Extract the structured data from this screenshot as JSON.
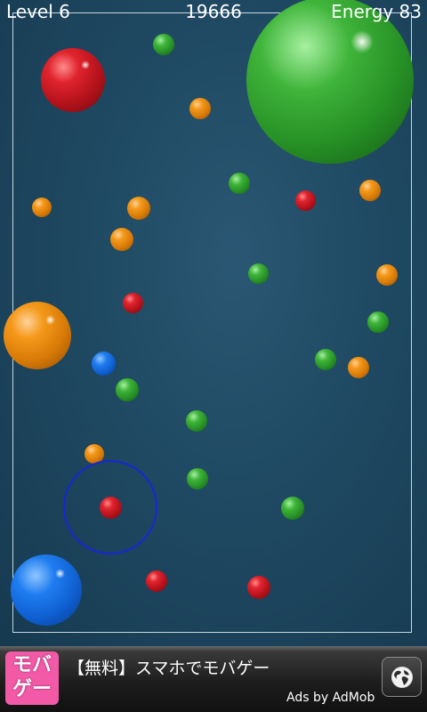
{
  "hud": {
    "level": "Level 6",
    "score": "19666",
    "energy": "Energy 83"
  },
  "balls": [
    {
      "color": "green"
    },
    {
      "color": "red"
    },
    {
      "color": "orange"
    },
    {
      "color": "blue"
    },
    {
      "color": "red"
    },
    {
      "color": "green"
    },
    {
      "color": "orange"
    },
    {
      "color": "green"
    },
    {
      "color": "orange"
    },
    {
      "color": "orange"
    },
    {
      "color": "red"
    },
    {
      "color": "orange"
    },
    {
      "color": "orange"
    },
    {
      "color": "green"
    },
    {
      "color": "orange"
    },
    {
      "color": "red"
    },
    {
      "color": "green"
    },
    {
      "color": "blue"
    },
    {
      "color": "green"
    },
    {
      "color": "orange"
    },
    {
      "color": "green"
    },
    {
      "color": "orange"
    },
    {
      "color": "green"
    },
    {
      "color": "red"
    },
    {
      "color": "green"
    },
    {
      "color": "green"
    },
    {
      "color": "red"
    }
  ],
  "colors": {
    "red": "#d61f28",
    "orange": "#f0901a",
    "green": "#35a832",
    "blue": "#1a72e6",
    "aim_ring": "#1a25d6",
    "background": "#1f4962",
    "ad_logo": "#f25aa8"
  },
  "ad": {
    "logo_line1": "モバ",
    "logo_line2": "ゲー",
    "text": "【無料】スマホでモバゲー",
    "attribution": "Ads by AdMob",
    "button_icon": "globe-icon"
  }
}
